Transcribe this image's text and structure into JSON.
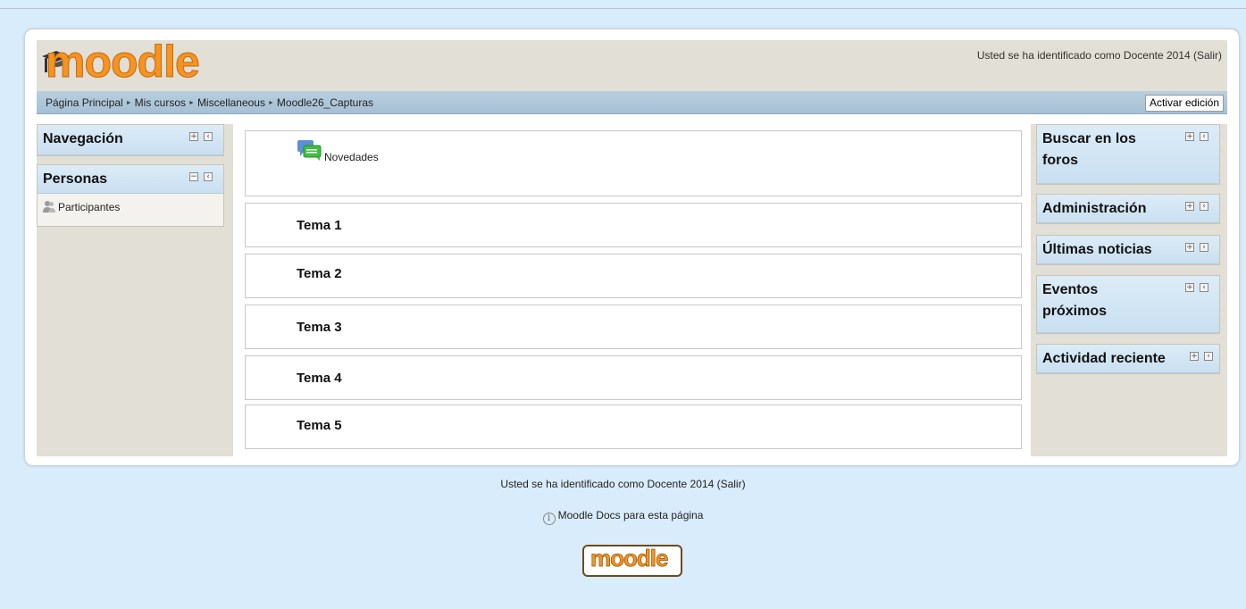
{
  "header": {
    "logo_text": "moodle",
    "login_info": "Usted se ha identificado como Docente 2014 (Salir)"
  },
  "navbar": {
    "breadcrumb": [
      "Página Principal",
      "Mis cursos",
      "Miscellaneous",
      "Moodle26_Capturas"
    ],
    "edit_button": "Activar edición"
  },
  "left_blocks": [
    {
      "title": "Navegación"
    },
    {
      "title": "Personas",
      "items": [
        "Participantes"
      ]
    }
  ],
  "sections": {
    "forum": "Novedades",
    "topics": [
      "Tema 1",
      "Tema 2",
      "Tema 3",
      "Tema 4",
      "Tema 5"
    ]
  },
  "right_blocks": [
    {
      "title": "Buscar en los foros",
      "title_lines": [
        "Buscar en los",
        "foros"
      ]
    },
    {
      "title": "Administración"
    },
    {
      "title": "Últimas noticias"
    },
    {
      "title": "Eventos próximos",
      "title_lines": [
        "Eventos",
        "próximos"
      ]
    },
    {
      "title": "Actividad reciente"
    }
  ],
  "footer": {
    "login_info": "Usted se ha identificado como Docente 2014 (Salir)",
    "docs_link": "Moodle Docs para esta página",
    "logo_text": "moodle"
  },
  "colors": {
    "background": "#d9ecfb",
    "brand_orange": "#f7931e",
    "block_header": "#c9dff0",
    "sidebar": "#e2dfd6"
  },
  "icons": [
    "graduation-cap-icon",
    "forum-icon",
    "participants-icon",
    "expand-icon",
    "dock-icon",
    "info-icon"
  ]
}
